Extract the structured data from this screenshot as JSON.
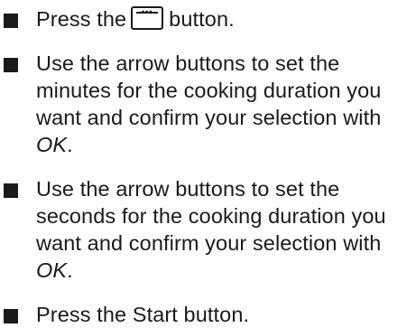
{
  "steps": [
    {
      "before": "Press the",
      "icon": "oven-timer-button-icon",
      "after": "button."
    },
    {
      "text": "Use the arrow buttons to set the minutes for the cooking duration you want and confirm your selection with",
      "emphasis": "OK",
      "end": "."
    },
    {
      "text": "Use the arrow buttons to set the seconds for the cooking duration you want and confirm your selection with",
      "emphasis": "OK",
      "end": "."
    },
    {
      "text": "Press the Start button."
    }
  ]
}
